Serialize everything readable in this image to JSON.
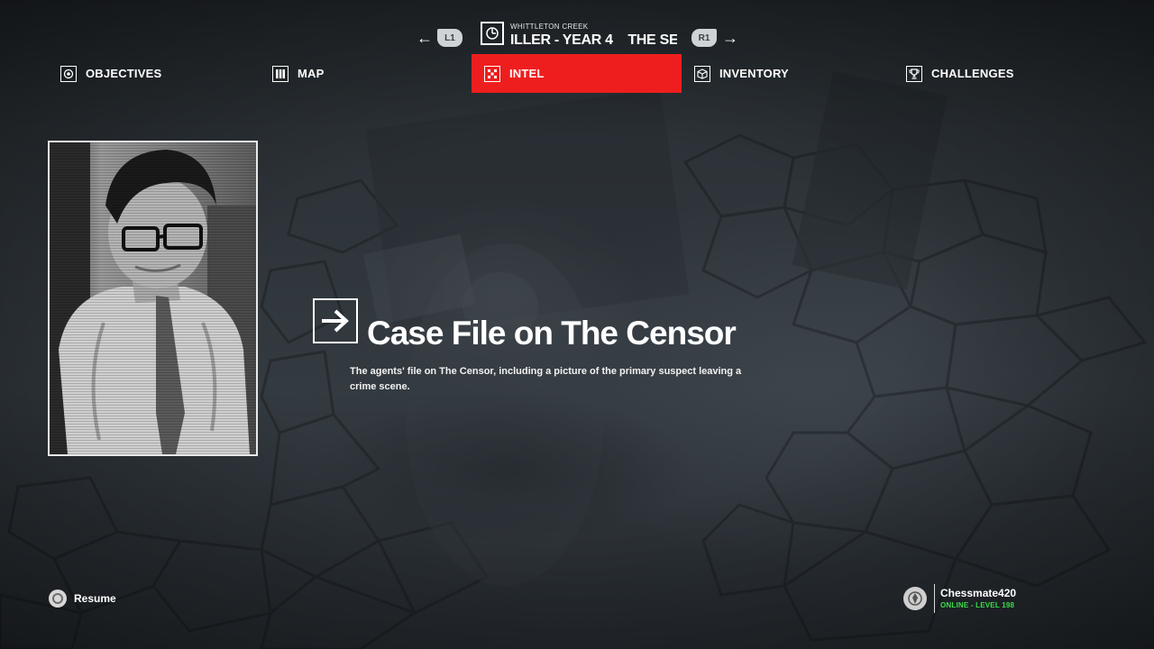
{
  "mission": {
    "prev_key": "L1",
    "next_key": "R1",
    "location": "WHITTLETON CREEK",
    "name": "ILLER - YEAR 4    THE SE"
  },
  "tabs": [
    {
      "label": "OBJECTIVES",
      "icon": "target-icon",
      "active": false
    },
    {
      "label": "MAP",
      "icon": "map-icon",
      "active": false
    },
    {
      "label": "INTEL",
      "icon": "intel-icon",
      "active": true
    },
    {
      "label": "INVENTORY",
      "icon": "box-icon",
      "active": false
    },
    {
      "label": "CHALLENGES",
      "icon": "trophy-icon",
      "active": false
    }
  ],
  "intel": {
    "title": "Case File on The Censor",
    "description": "The agents' file on The Censor, including a picture of the primary suspect leaving a crime scene."
  },
  "footer": {
    "resume_label": "Resume",
    "player_name": "Chessmate420",
    "player_status": "ONLINE - LEVEL 198"
  },
  "colors": {
    "accent": "#ef1e1e",
    "online": "#3cdc49"
  }
}
